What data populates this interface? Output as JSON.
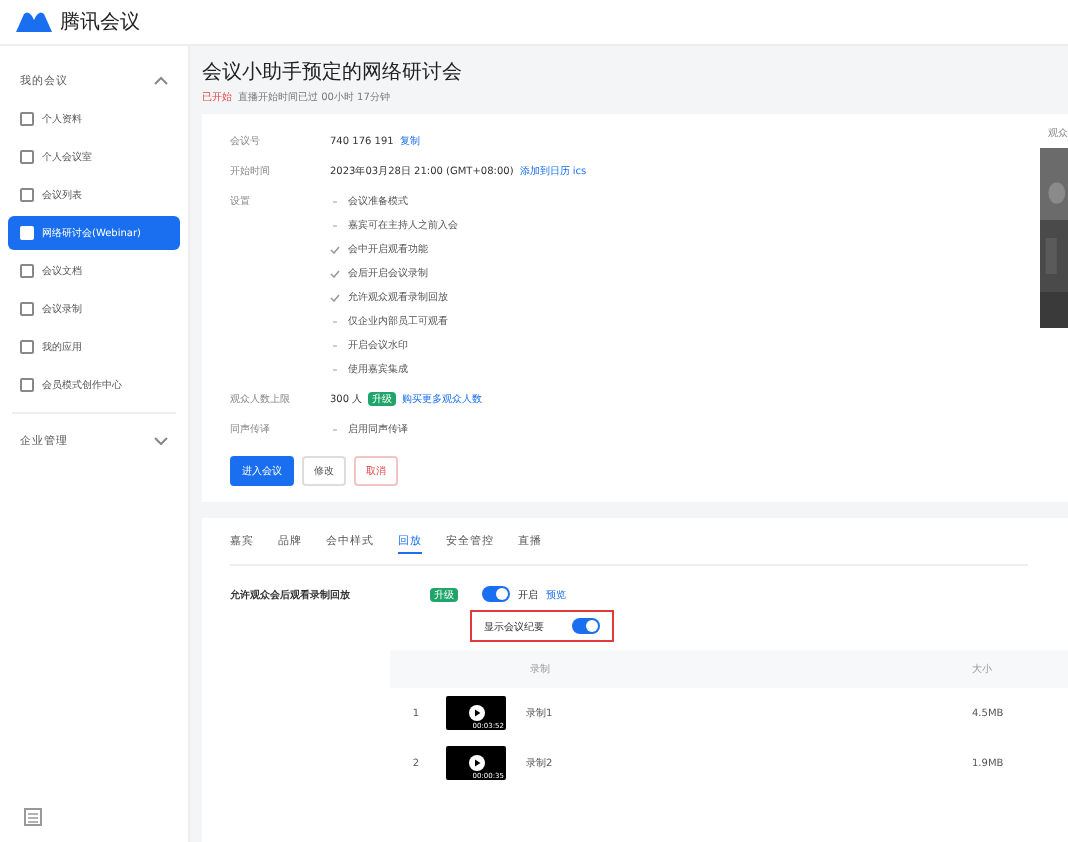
{
  "app": {
    "name": "腾讯会议"
  },
  "sidebar": {
    "groups": [
      {
        "label": "我的会议",
        "expanded": true,
        "items": [
          {
            "label": "个人资料",
            "selected": false
          },
          {
            "label": "个人会议室",
            "selected": false
          },
          {
            "label": "会议列表",
            "selected": false
          },
          {
            "label": "网络研讨会(Webinar)",
            "selected": true
          },
          {
            "label": "会议文档",
            "selected": false
          },
          {
            "label": "会议录制",
            "selected": false
          },
          {
            "label": "我的应用",
            "selected": false
          },
          {
            "label": "会员模式创作中心",
            "selected": false
          }
        ]
      },
      {
        "label": "企业管理",
        "expanded": false
      }
    ]
  },
  "meeting": {
    "title": "会议小助手预定的网络研讨会",
    "status": "已开始",
    "status_note": "直播开始时间已过 00小时 17分钟",
    "fields": [
      {
        "kind": "id",
        "label": "会议号",
        "value": "740 176 191",
        "link": "复制"
      },
      {
        "kind": "time",
        "label": "开始时间",
        "value": "2023年03月28日 21:00 (GMT+08:00)",
        "link": "添加到日历 ics"
      },
      {
        "kind": "settings",
        "label": "设置",
        "options": [
          {
            "text": "会议准备模式",
            "checked": false
          },
          {
            "text": "嘉宾可在主持人之前入会",
            "checked": false
          },
          {
            "text": "会中开启观看功能",
            "checked": true
          },
          {
            "text": "会后开启会议录制",
            "checked": true
          },
          {
            "text": "允许观众观看录制回放",
            "checked": true
          },
          {
            "text": "仅企业内部员工可观看",
            "checked": false
          },
          {
            "text": "开启会议水印",
            "checked": false
          },
          {
            "text": "使用嘉宾集成",
            "checked": false
          }
        ]
      },
      {
        "kind": "limit",
        "label": "观众人数上限",
        "value": "300 人",
        "badge": "升级",
        "link": "购买更多观众人数"
      },
      {
        "kind": "settings",
        "label": "同声传译",
        "options": [
          {
            "text": "启用同声传译",
            "checked": false
          }
        ]
      }
    ],
    "buttons": [
      {
        "label": "进入会议",
        "kind": "primary"
      },
      {
        "label": "修改",
        "kind": "default"
      },
      {
        "label": "取消",
        "kind": "danger"
      }
    ],
    "side_label": "观众"
  },
  "tabs": [
    {
      "label": "嘉宾",
      "selected": false
    },
    {
      "label": "品牌",
      "selected": false
    },
    {
      "label": "会中样式",
      "selected": false
    },
    {
      "label": "回放",
      "selected": true
    },
    {
      "label": "安全管控",
      "selected": false
    },
    {
      "label": "直播",
      "selected": false
    }
  ],
  "replay": {
    "label": "允许观众会后观看录制回放",
    "badge": "升级",
    "on": true,
    "on_text": "开启",
    "link": "预览",
    "minutes": {
      "label": "显示会议纪要",
      "on": true
    },
    "columns": [
      "录制",
      "大小"
    ],
    "rows": [
      {
        "index": "1",
        "duration": "00:03:52",
        "name": "录制1",
        "size": "4.5MB"
      },
      {
        "index": "2",
        "duration": "00:00:35",
        "name": "录制2",
        "size": "1.9MB"
      }
    ]
  }
}
